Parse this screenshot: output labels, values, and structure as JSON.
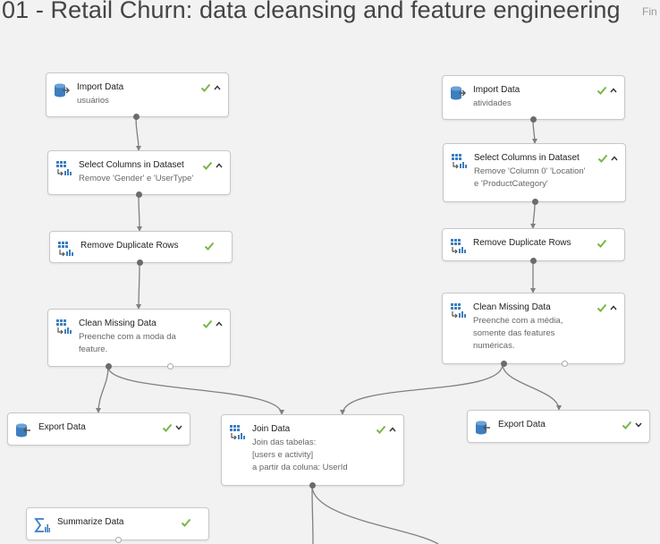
{
  "header": {
    "title": "01 - Retail Churn: data cleansing and feature engineering",
    "find_label": "Fin"
  },
  "colors": {
    "check": "#7ab648",
    "icon": "#3c7ec0",
    "wire": "#808080"
  },
  "nodes": {
    "import_users": {
      "name": "Import Data",
      "desc": [
        "usuários"
      ],
      "icon": "database-import-icon",
      "status": "check-up"
    },
    "select_users": {
      "name": "Select Columns in Dataset",
      "desc": [
        "Remove 'Gender' e 'UserType'"
      ],
      "icon": "table-transform-icon",
      "status": "check-up"
    },
    "dedupe_users": {
      "name": "Remove Duplicate Rows",
      "desc": [],
      "icon": "table-transform-icon",
      "status": "check"
    },
    "clean_users": {
      "name": "Clean Missing Data",
      "desc": [
        "Preenche com a moda da",
        "feature."
      ],
      "icon": "table-transform-icon",
      "status": "check-up"
    },
    "export_users": {
      "name": "Export Data",
      "desc": [],
      "icon": "database-export-icon",
      "status": "check-down"
    },
    "import_activity": {
      "name": "Import Data",
      "desc": [
        "atividades"
      ],
      "icon": "database-import-icon",
      "status": "check-up"
    },
    "select_activity": {
      "name": "Select Columns in Dataset",
      "desc": [
        "Remove 'Column 0' 'Location'",
        "e 'ProductCategory'"
      ],
      "icon": "table-transform-icon",
      "status": "check-up"
    },
    "dedupe_activity": {
      "name": "Remove Duplicate Rows",
      "desc": [],
      "icon": "table-transform-icon",
      "status": "check"
    },
    "clean_activity": {
      "name": "Clean Missing Data",
      "desc": [
        "Preenche com a média,",
        "somente das features",
        "numéricas."
      ],
      "icon": "table-transform-icon",
      "status": "check-up"
    },
    "export_activity": {
      "name": "Export Data",
      "desc": [],
      "icon": "database-export-icon",
      "status": "check-down"
    },
    "join": {
      "name": "Join Data",
      "desc": [
        "Join das tabelas:",
        "[users e activity]",
        "a partir da coluna: UserId"
      ],
      "icon": "table-transform-icon",
      "status": "check-up"
    },
    "summarize": {
      "name": "Summarize Data",
      "desc": [],
      "icon": "sigma-icon",
      "status": "check"
    }
  }
}
